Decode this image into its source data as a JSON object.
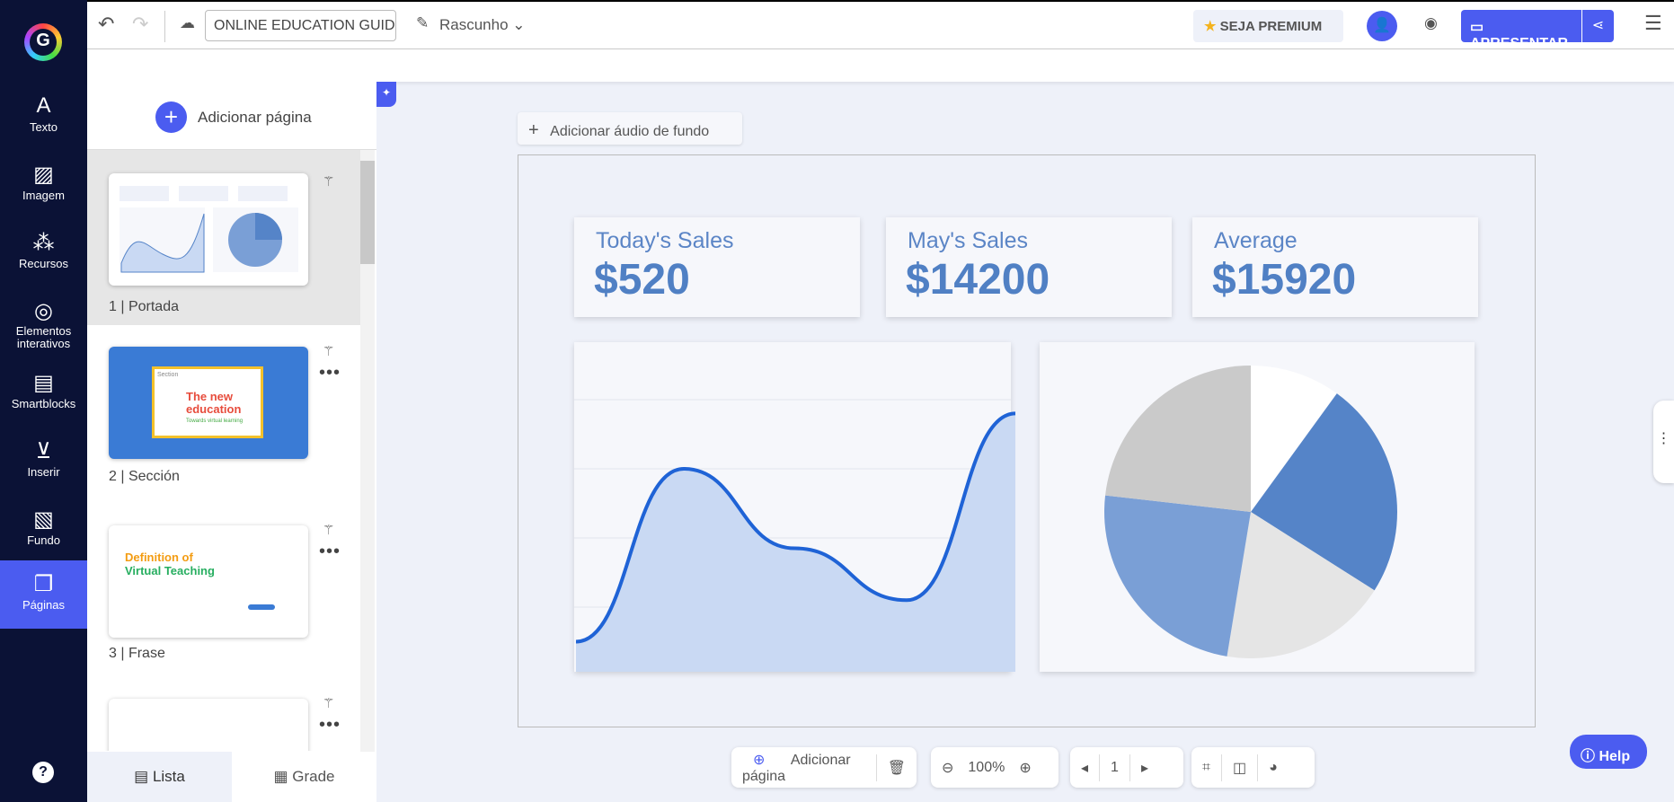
{
  "sidebar": {
    "items": [
      {
        "label": "Texto",
        "icon": "text-icon"
      },
      {
        "label": "Imagem",
        "icon": "image-icon"
      },
      {
        "label": "Recursos",
        "icon": "resources-icon"
      },
      {
        "label": "Elementos interativos",
        "icon": "interactive-icon"
      },
      {
        "label": "Smartblocks",
        "icon": "smartblocks-icon"
      },
      {
        "label": "Inserir",
        "icon": "insert-icon"
      },
      {
        "label": "Fundo",
        "icon": "background-icon"
      },
      {
        "label": "Páginas",
        "icon": "pages-icon"
      }
    ],
    "help": "?"
  },
  "topbar": {
    "title": "ONLINE EDUCATION GUIDE",
    "status": "Rascunho",
    "premium": "SEJA PREMIUM",
    "present": "APRESENTAR",
    "accent": "#4b5cf0"
  },
  "panel": {
    "add_page": "Adicionar página",
    "pages": [
      {
        "num": "1 |",
        "name": "Portada"
      },
      {
        "num": "2 |",
        "name": "Sección"
      },
      {
        "num": "3 |",
        "name": "Frase"
      }
    ],
    "thumb2": {
      "label": "Section",
      "title1": "The new",
      "title2": "education",
      "sub": "Towards virtual learning"
    },
    "thumb3": {
      "title1": "Definition of",
      "title2": "Virtual Teaching"
    },
    "tabs": {
      "list": "Lista",
      "grid": "Grade"
    }
  },
  "canvas": {
    "add_audio": "Adicionar áudio de fundo",
    "cards": [
      {
        "title": "Today's Sales",
        "value": "$520"
      },
      {
        "title": "May's Sales",
        "value": "$14200"
      },
      {
        "title": "Average",
        "value": "$15920"
      }
    ],
    "line": {
      "values": [
        0.5,
        3,
        1.85,
        1.1,
        3.8
      ],
      "fill": "#c9d9f3",
      "stroke": "#1f63d6"
    },
    "pie": {
      "shares": [
        10,
        24,
        18.6,
        24.2,
        23.2
      ],
      "colors": [
        "#ffffff",
        "#5584c8",
        "#e5e5e5",
        "#7a9fd6",
        "#cacaca"
      ]
    }
  },
  "bottom": {
    "add_page": "Adicionar página",
    "zoom": "100%",
    "page": "1",
    "help": "Help"
  }
}
